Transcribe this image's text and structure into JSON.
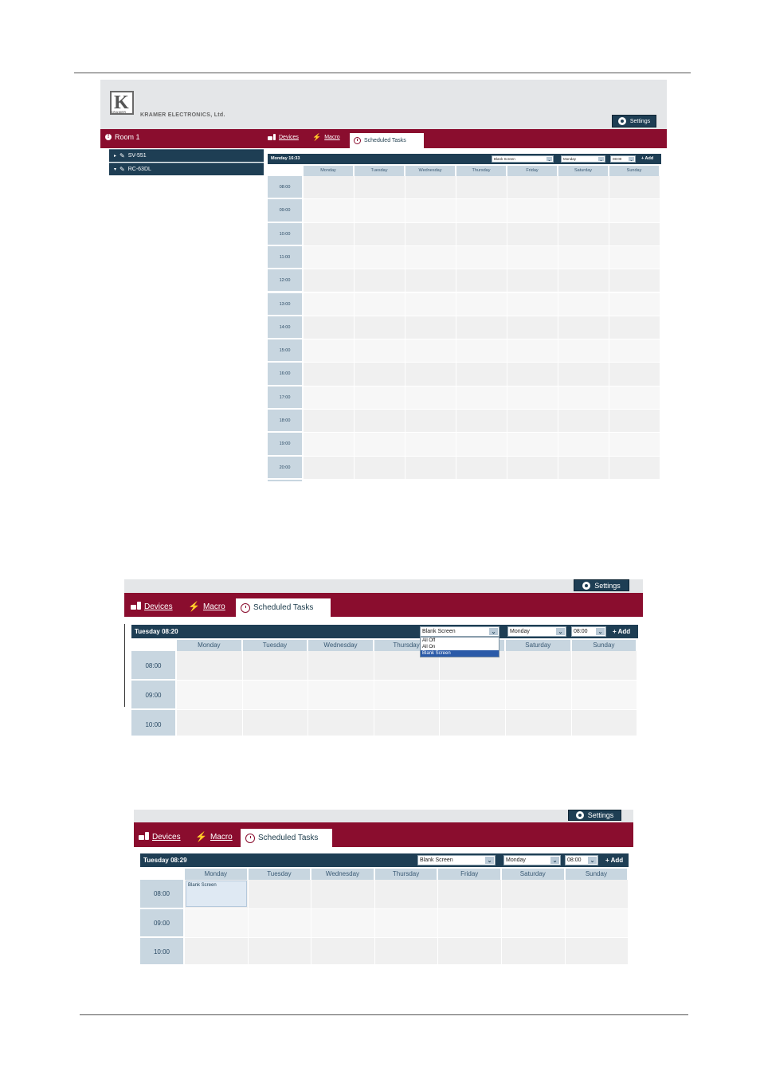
{
  "days": [
    "Monday",
    "Tuesday",
    "Wednesday",
    "Thursday",
    "Friday",
    "Saturday",
    "Sunday"
  ],
  "colors": {
    "burgundy": "#8a0d2e",
    "navy": "#1e3e54",
    "header_blue": "#c8d6e0"
  },
  "screenshot1": {
    "logo_letter": "K",
    "logo_small": "KRAMER",
    "company": "KRAMER ELECTRONICS, Ltd.",
    "settings_label": "Settings",
    "room_label": "Room 1",
    "devices": [
      {
        "expand": "▸",
        "label": "SV-551"
      },
      {
        "expand": "▾",
        "label": "RC-63DL"
      }
    ],
    "tabs": {
      "devices": "Devices",
      "macro": "Macro",
      "scheduled": "Scheduled Tasks"
    },
    "now": "Monday 16:33",
    "action_select": "Blank Screen",
    "day_select": "Monday",
    "time_select": "08:00",
    "add_label": "+  Add",
    "times": [
      "08:00",
      "09:00",
      "10:00",
      "11:00",
      "12:00",
      "13:00",
      "14:00",
      "15:00",
      "16:00",
      "17:00",
      "18:00",
      "19:00",
      "20:00"
    ]
  },
  "screenshot2": {
    "settings_label": "Settings",
    "tabs": {
      "devices": "Devices",
      "macro": "Macro",
      "scheduled": "Scheduled Tasks"
    },
    "now": "Tuesday 08:20",
    "action_select": "Blank Screen",
    "dropdown_options": [
      "All Off",
      "All On",
      "Blank Screen"
    ],
    "day_select": "Monday",
    "time_select": "08:00",
    "add_label": "+  Add",
    "times": [
      "08:00",
      "09:00",
      "10:00"
    ]
  },
  "screenshot3": {
    "settings_label": "Settings",
    "tabs": {
      "devices": "Devices",
      "macro": "Macro",
      "scheduled": "Scheduled Tasks"
    },
    "now": "Tuesday 08:29",
    "action_select": "Blank Screen",
    "day_select": "Monday",
    "time_select": "08:00",
    "add_label": "+  Add",
    "times": [
      "08:00",
      "09:00",
      "10:00"
    ],
    "task": "Blank Screen"
  }
}
